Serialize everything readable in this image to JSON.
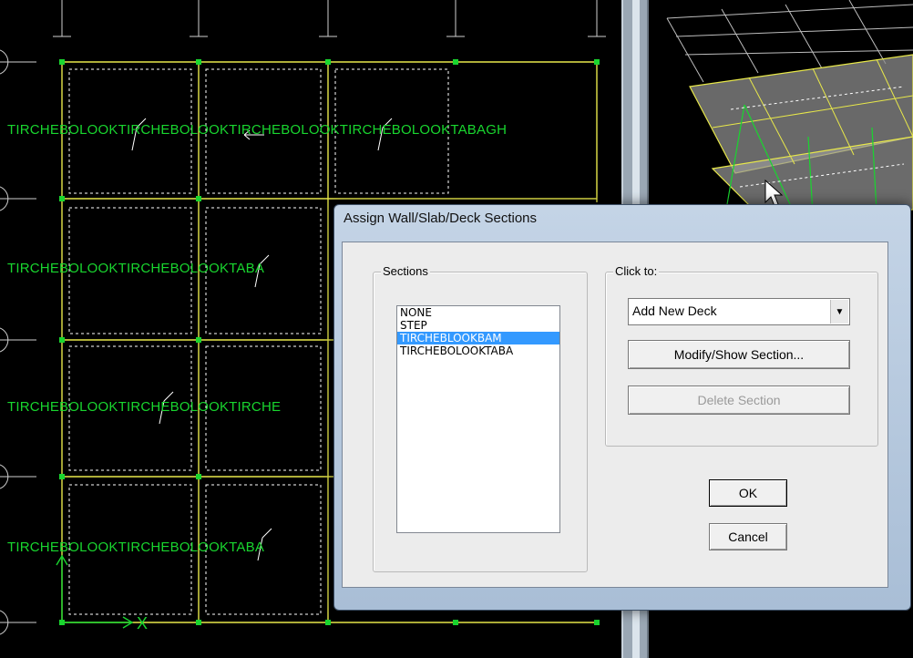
{
  "plan_view": {
    "slab_labels": [
      "TIRCHEBOLOOKTIRCHEBOLOOKTIRCHEBOLOOKTIRCHEBOLOOKTABAGH",
      "TIRCHEBOLOOKTIRCHEBOLOOKTABA",
      "TIRCHEBOLOOKTIRCHEBOLOOKTIRCHE",
      "TIRCHEBOLOOKTIRCHEBOLOOKTABA"
    ],
    "axis_x_label": "X"
  },
  "dialog": {
    "title": "Assign Wall/Slab/Deck Sections",
    "sections_group_label": "Sections",
    "sections": [
      "NONE",
      "STEP",
      "TIRCHEBLOOKBAM",
      "TIRCHEBOLOOKTABA"
    ],
    "selected_section_index": 2,
    "click_to_group_label": "Click to:",
    "click_to_selected": "Add New Deck",
    "modify_button": "Modify/Show Section...",
    "delete_button": "Delete Section",
    "ok_button": "OK",
    "cancel_button": "Cancel"
  },
  "colors": {
    "label_green": "#19d62f",
    "grid_yellow": "#e8e84a",
    "selection_blue": "#3399ff"
  }
}
